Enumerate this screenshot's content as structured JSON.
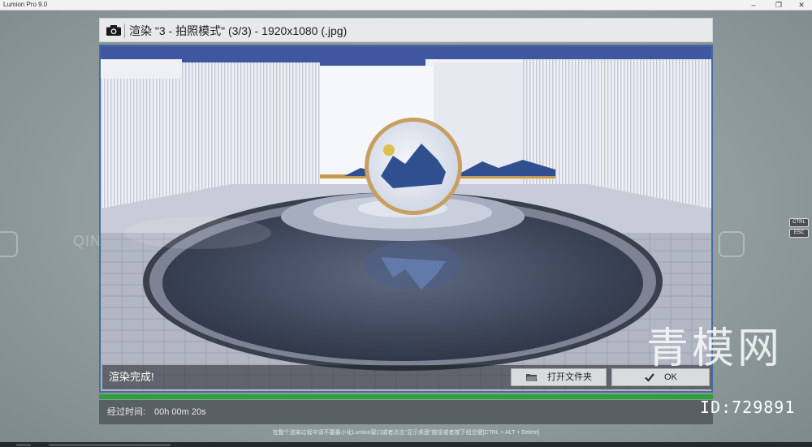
{
  "app": {
    "window_title": "Lumion Pro 9.0"
  },
  "dialog": {
    "title": "渲染 \"3 - 拍照模式\" (3/3) - 1920x1080 (.jpg)",
    "status_text": "渲染完成!",
    "open_folder_label": "打开文件夹",
    "ok_label": "OK",
    "progress_fraction": 1.0,
    "elapsed_label": "经过时间:",
    "elapsed_value": "00h 00m 20s"
  },
  "hint": "在整个渲染过程中请不要最小化Lumion窗口或者点击\"显示桌面\"按钮或者按下组合键[CTRL + ALT + Delete]",
  "shortcuts": {
    "ctrl": "CTRL",
    "esc": "ESC"
  },
  "watermark": {
    "text": "QINGMO.COM",
    "logo": "青模网",
    "id": "ID:729891"
  },
  "colors": {
    "accent_border": "#4a6c9c",
    "progress": "#2ea23a"
  }
}
